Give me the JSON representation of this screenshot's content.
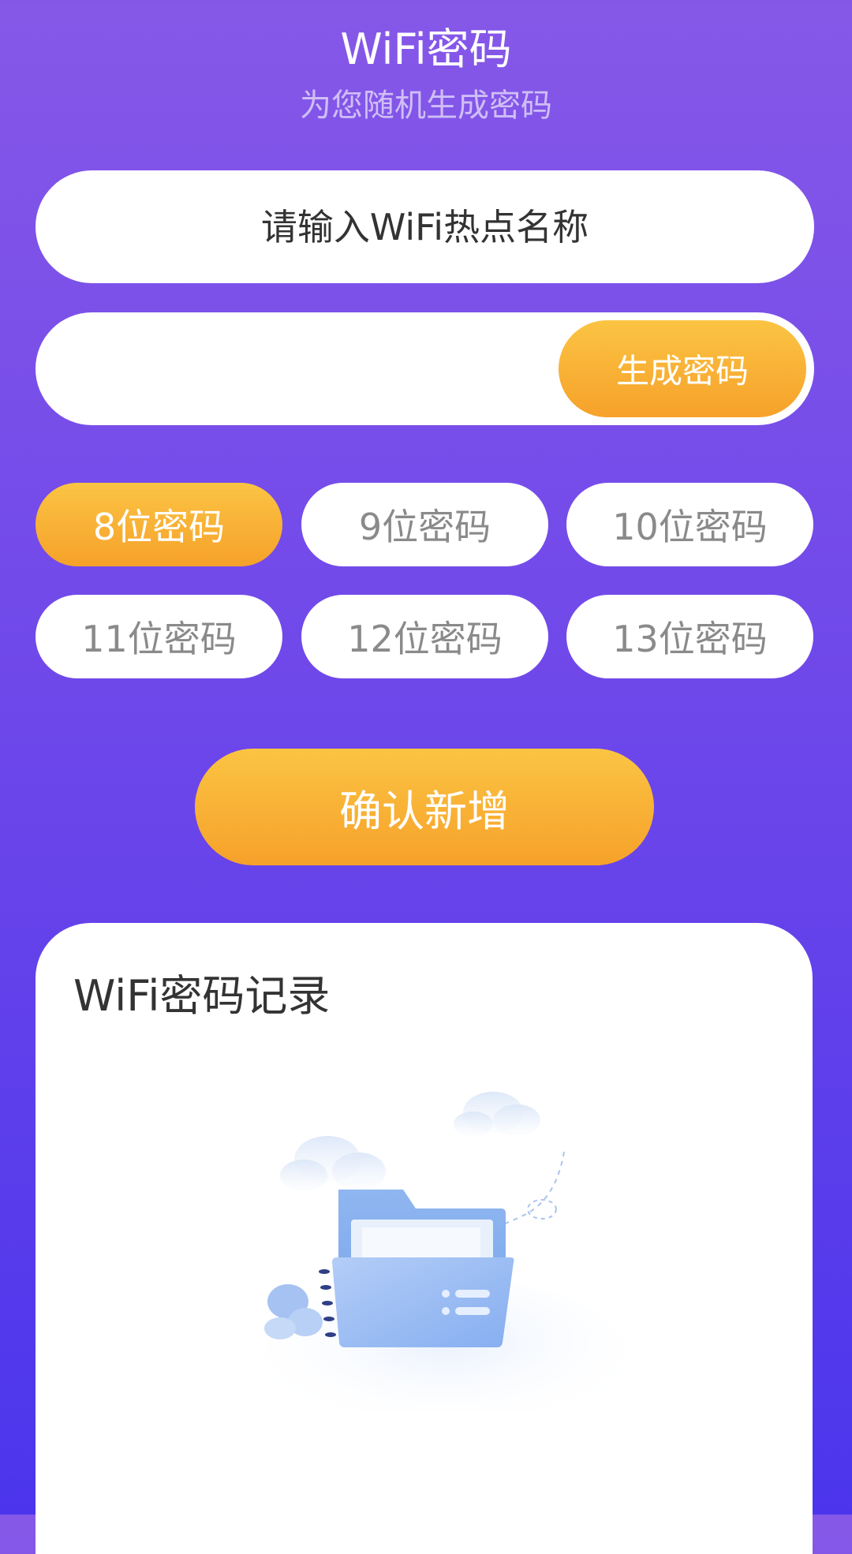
{
  "header": {
    "title": "WiFi密码",
    "subtitle": "为您随机生成密码"
  },
  "form": {
    "ssid_placeholder": "请输入WiFi热点名称",
    "password_value": "",
    "generate_label": "生成密码",
    "length_options": [
      {
        "label": "8位密码",
        "selected": true
      },
      {
        "label": "9位密码",
        "selected": false
      },
      {
        "label": "10位密码",
        "selected": false
      },
      {
        "label": "11位密码",
        "selected": false
      },
      {
        "label": "12位密码",
        "selected": false
      },
      {
        "label": "13位密码",
        "selected": false
      }
    ],
    "confirm_label": "确认新增"
  },
  "records": {
    "title": "WiFi密码记录",
    "empty_icon": "empty-folder-illustration"
  },
  "colors": {
    "gradient_top": "#8658e8",
    "gradient_bottom": "#4b35ec",
    "accent_top": "#fbc443",
    "accent_bottom": "#f6a12a",
    "text_dark": "#333333",
    "text_muted": "#8a8a8a"
  }
}
